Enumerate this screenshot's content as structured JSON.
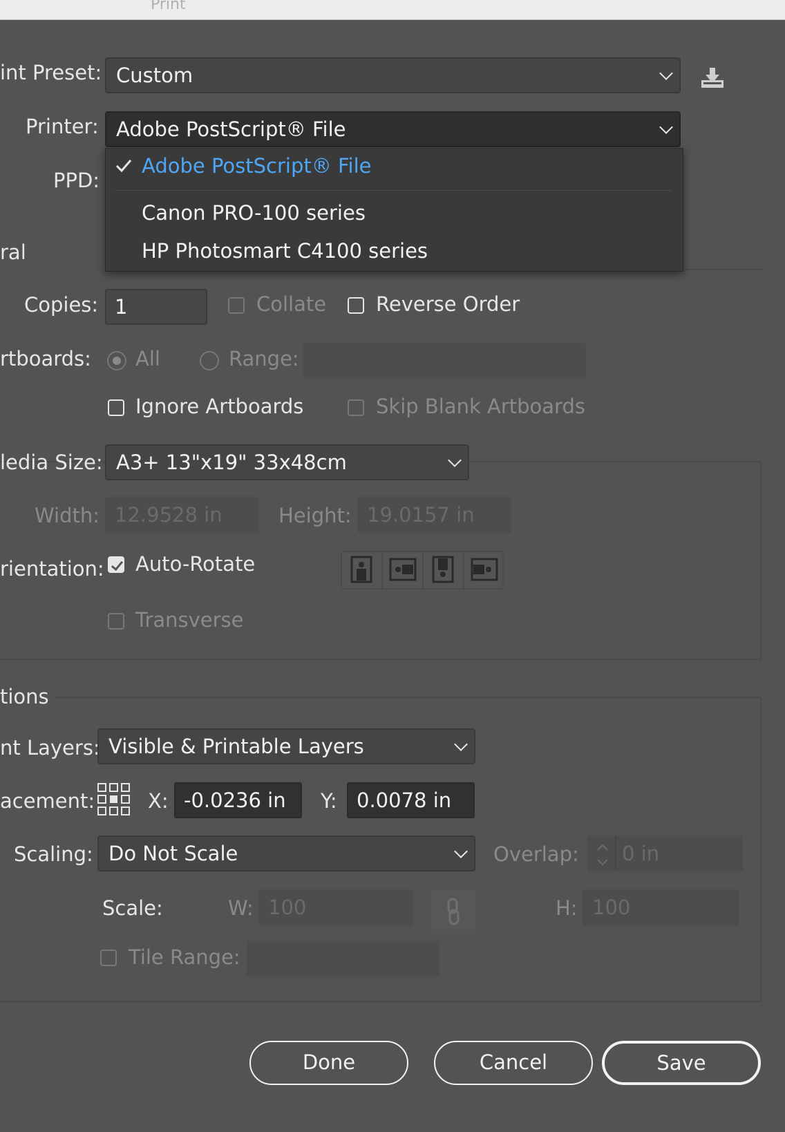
{
  "window": {
    "title": "Print"
  },
  "preset": {
    "label": "int Preset:",
    "value": "Custom"
  },
  "printer": {
    "label": "Printer:",
    "value": "Adobe PostScript® File",
    "options": [
      "Adobe PostScript® File",
      "Canon PRO-100 series",
      "HP Photosmart C4100 series"
    ]
  },
  "ppd": {
    "label": "PPD:"
  },
  "general": {
    "heading": "ral",
    "copies_label": "Copies:",
    "copies_value": "1",
    "collate": "Collate",
    "reverse_order": "Reverse Order",
    "artboards_label": "rtboards:",
    "all": "All",
    "range": "Range:",
    "ignore_artboards": "Ignore Artboards",
    "skip_blank": "Skip Blank Artboards",
    "media_label": "ledia Size:",
    "media_value": "A3+ 13\"x19\" 33x48cm",
    "width_label": "Width:",
    "width_value": "12.9528 in",
    "height_label": "Height:",
    "height_value": "19.0157 in",
    "orientation_label": "rientation:",
    "auto_rotate": "Auto-Rotate",
    "auto_rotate_checked": true,
    "transverse": "Transverse"
  },
  "options": {
    "heading": "tions",
    "layers_label": "nt Layers:",
    "layers_value": "Visible & Printable Layers",
    "placement_label": "acement:",
    "x_label": "X:",
    "x_value": "-0.0236 in",
    "y_label": "Y:",
    "y_value": "0.0078 in",
    "scaling_label": "Scaling:",
    "scaling_value": "Do Not Scale",
    "overlap_label": "Overlap:",
    "overlap_value": "0 in",
    "scale_label": "Scale:",
    "w_label": "W:",
    "w_value": "100",
    "h_label": "H:",
    "h_value": "100",
    "tile_range": "Tile Range:"
  },
  "buttons": {
    "done": "Done",
    "cancel": "Cancel",
    "save": "Save"
  }
}
